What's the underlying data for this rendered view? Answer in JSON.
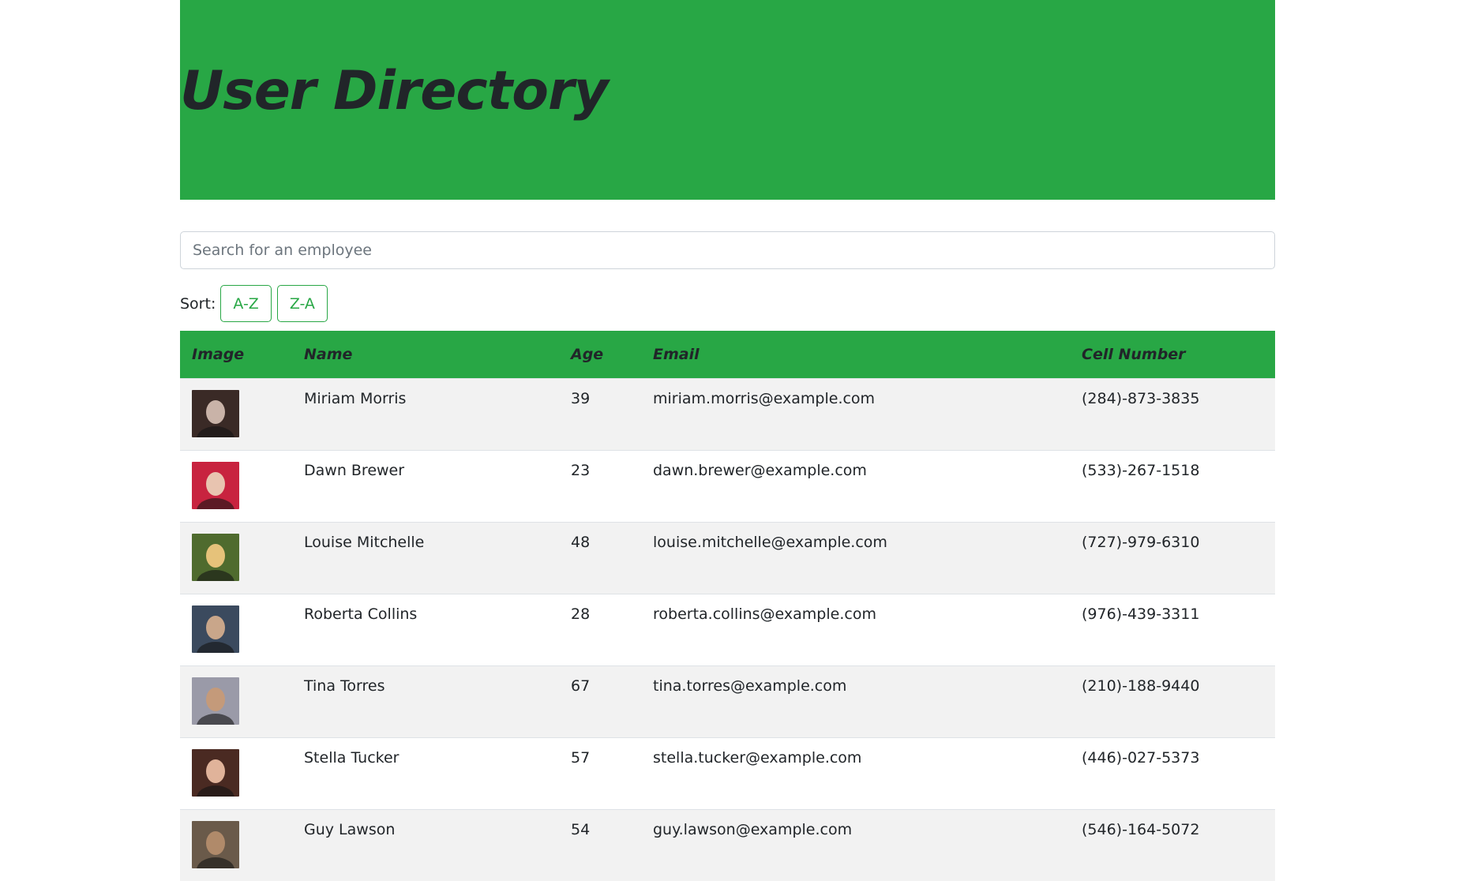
{
  "header": {
    "title": "User Directory"
  },
  "search": {
    "placeholder": "Search for an employee",
    "value": ""
  },
  "sort": {
    "label": "Sort:",
    "buttons": [
      "A-Z",
      "Z-A"
    ]
  },
  "table": {
    "columns": [
      "Image",
      "Name",
      "Age",
      "Email",
      "Cell Number"
    ],
    "rows": [
      {
        "name": "Miriam Morris",
        "age": "39",
        "email": "miriam.morris@example.com",
        "cell": "(284)-873-3835",
        "avatar_colors": [
          "#3a2a26",
          "#c9b3a8"
        ]
      },
      {
        "name": "Dawn Brewer",
        "age": "23",
        "email": "dawn.brewer@example.com",
        "cell": "(533)-267-1518",
        "avatar_colors": [
          "#c8233f",
          "#e8c4b0"
        ]
      },
      {
        "name": "Louise Mitchelle",
        "age": "48",
        "email": "louise.mitchelle@example.com",
        "cell": "(727)-979-6310",
        "avatar_colors": [
          "#4f6b2e",
          "#e6c27a"
        ]
      },
      {
        "name": "Roberta Collins",
        "age": "28",
        "email": "roberta.collins@example.com",
        "cell": "(976)-439-3311",
        "avatar_colors": [
          "#3b4a5e",
          "#c9a68a"
        ]
      },
      {
        "name": "Tina Torres",
        "age": "67",
        "email": "tina.torres@example.com",
        "cell": "(210)-188-9440",
        "avatar_colors": [
          "#9a9aa8",
          "#c49a7a"
        ]
      },
      {
        "name": "Stella Tucker",
        "age": "57",
        "email": "stella.tucker@example.com",
        "cell": "(446)-027-5373",
        "avatar_colors": [
          "#4a2a22",
          "#e0b39a"
        ]
      },
      {
        "name": "Guy Lawson",
        "age": "54",
        "email": "guy.lawson@example.com",
        "cell": "(546)-164-5072",
        "avatar_colors": [
          "#6a5a4a",
          "#b08a6a"
        ]
      }
    ]
  },
  "colors": {
    "brand": "#28a745",
    "text": "#212529",
    "row_stripe": "#f2f2f2"
  }
}
